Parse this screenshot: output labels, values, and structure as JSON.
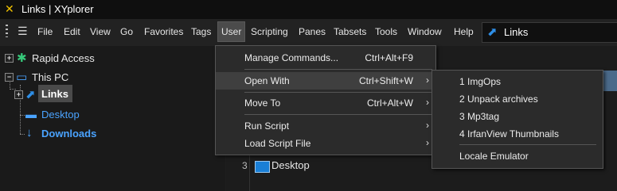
{
  "window": {
    "title": "Links | XYplorer"
  },
  "menubar": {
    "items": [
      "File",
      "Edit",
      "View",
      "Go",
      "Favorites",
      "Tags",
      "User",
      "Scripting",
      "Panes",
      "Tabsets",
      "Tools",
      "Window",
      "Help"
    ],
    "active": "User"
  },
  "address": {
    "value": "Links"
  },
  "tree": {
    "rapid_access": "Rapid Access",
    "this_pc": "This PC",
    "links": "Links",
    "desktop": "Desktop",
    "downloads": "Downloads"
  },
  "user_menu": {
    "items": [
      {
        "label": "Manage Commands...",
        "shortcut": "Ctrl+Alt+F9",
        "submenu": false
      },
      {
        "label": "Open With",
        "shortcut": "Ctrl+Shift+W",
        "submenu": true
      },
      {
        "label": "Move To",
        "shortcut": "Ctrl+Alt+W",
        "submenu": true
      },
      {
        "label": "Run Script",
        "shortcut": "",
        "submenu": true
      },
      {
        "label": "Load Script File",
        "shortcut": "",
        "submenu": true
      }
    ]
  },
  "open_with_submenu": {
    "items": [
      "1 ImgOps",
      "2 Unpack archives",
      "3 Mp3tag",
      "4 IrfanView Thumbnails",
      "Locale Emulator"
    ]
  },
  "list": {
    "row3_number": "3",
    "row3_name": "Desktop"
  },
  "colors": {
    "accent": "#2e8ee6",
    "bg": "#1e1e1e",
    "menu_bg": "#2b2b2b"
  }
}
